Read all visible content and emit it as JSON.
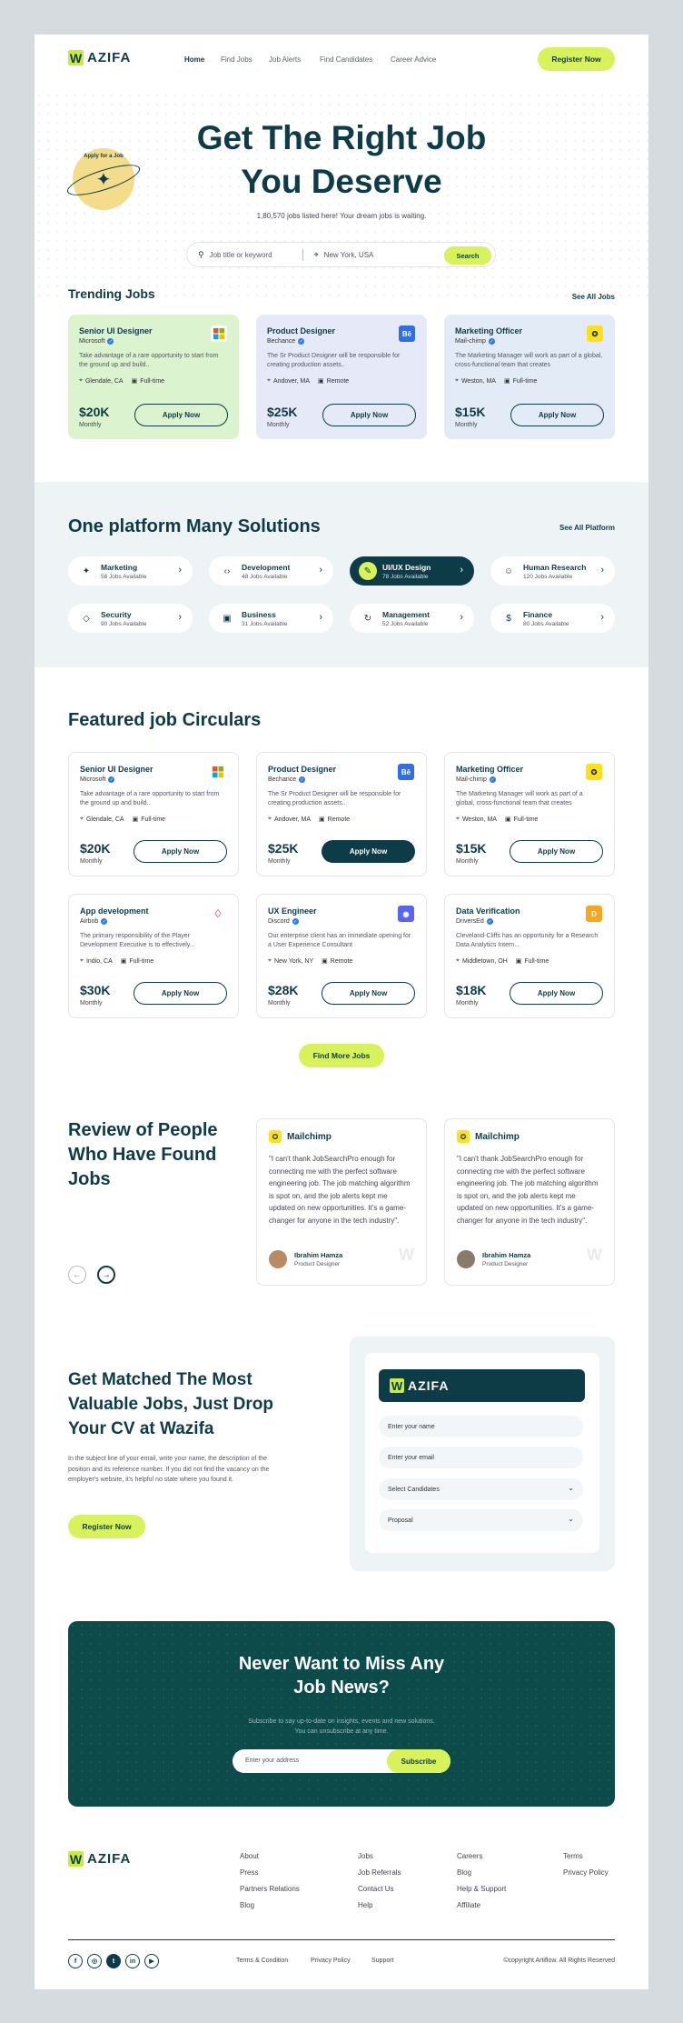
{
  "brand": {
    "logo_mark": "W",
    "logo_text": "AZIFA"
  },
  "nav": {
    "items": [
      "Home",
      "Find Jobs",
      "Job Alerts",
      "Find Candidates",
      "Career Advice"
    ],
    "cta": "Register Now"
  },
  "hero": {
    "title_line1": "Get The Right Job",
    "title_line2": "You Deserve",
    "badge": "Apply for a Job",
    "subtitle": "1,80,570 jobs listed here! Your dream jobs is waiting.",
    "search_placeholder": "Job title or keyword",
    "location_placeholder": "New York, USA",
    "search_button": "Search"
  },
  "trending": {
    "title": "Trending Jobs",
    "see_all": "See All Jobs",
    "jobs": [
      {
        "title": "Senior UI Designer",
        "company": "Microsoft",
        "desc": "Take advantage of a rare opportunity to start from the ground up and build..",
        "location": "Glendale, CA",
        "type": "Full-time",
        "salary": "$20K",
        "period": "Monthly",
        "apply": "Apply Now"
      },
      {
        "title": "Product Designer",
        "company": "Bechance",
        "desc": "The Sr Product Designer will be responsible for creating production assets..",
        "location": "Andover, MA",
        "type": "Remote",
        "salary": "$25K",
        "period": "Monthly",
        "apply": "Apply Now"
      },
      {
        "title": "Marketing Officer",
        "company": "Mail-chimp",
        "desc": "The Marketing Manager will work as part of a global, cross-functional team that creates",
        "location": "Weston, MA",
        "type": "Full-time",
        "salary": "$15K",
        "period": "Monthly",
        "apply": "Apply Now"
      }
    ]
  },
  "platform": {
    "title": "One platform Many Solutions",
    "see_all": "See All Platform",
    "categories": [
      {
        "name": "Marketing",
        "count": "58 Jobs Available",
        "icon": "megaphone-icon",
        "glyph": "✦"
      },
      {
        "name": "Development",
        "count": "48 Jobs Available",
        "icon": "code-icon",
        "glyph": "‹›"
      },
      {
        "name": "UI/UX Design",
        "count": "78 Jobs Available",
        "icon": "pen-icon",
        "glyph": "✎"
      },
      {
        "name": "Human Research",
        "count": "120 Jobs Available",
        "icon": "people-icon",
        "glyph": "☺"
      },
      {
        "name": "Security",
        "count": "90 Jobs Available",
        "icon": "shield-icon",
        "glyph": "◇"
      },
      {
        "name": "Business",
        "count": "31 Jobs Available",
        "icon": "briefcase-icon",
        "glyph": "▣"
      },
      {
        "name": "Management",
        "count": "52 Jobs Available",
        "icon": "refresh-icon",
        "glyph": "↻"
      },
      {
        "name": "Finance",
        "count": "80 Jobs Available",
        "icon": "money-icon",
        "glyph": "$"
      }
    ]
  },
  "featured": {
    "title": "Featured job Circulars",
    "more": "Find More Jobs",
    "jobs": [
      {
        "title": "Senior UI Designer",
        "company": "Microsoft",
        "desc": "Take advantage of a rare opportunity to start from the ground up and build..",
        "location": "Glendale, CA",
        "type": "Full-time",
        "salary": "$20K",
        "period": "Monthly",
        "apply": "Apply Now"
      },
      {
        "title": "Product Designer",
        "company": "Bechance",
        "desc": "The Sr Product Designer will be responsible for creating production assets..",
        "location": "Andover, MA",
        "type": "Remote",
        "salary": "$25K",
        "period": "Monthly",
        "apply": "Apply Now"
      },
      {
        "title": "Marketing Officer",
        "company": "Mail-chimp",
        "desc": "The Marketing Manager will work as part of a global, cross-functional team that creates",
        "location": "Weston, MA",
        "type": "Full-time",
        "salary": "$15K",
        "period": "Monthly",
        "apply": "Apply Now"
      },
      {
        "title": "App development",
        "company": "Airbnb",
        "desc": "The primary responsibility of the Player Development Executive is to effectively...",
        "location": "Indio, CA",
        "type": "Full-time",
        "salary": "$30K",
        "period": "Monthly",
        "apply": "Apply Now"
      },
      {
        "title": "UX Engineer",
        "company": "Discord",
        "desc": "Our enterprise client has an immediate opening for a User Experience Consultant",
        "location": "New York, NY",
        "type": "Remote",
        "salary": "$28K",
        "period": "Monthly",
        "apply": "Apply Now"
      },
      {
        "title": "Data Verification",
        "company": "DriversEd",
        "desc": "Cleveland-Cliffs has an opportunity for a Research Data Analytics Intern...",
        "location": "Middletown, OH",
        "type": "Full-time",
        "salary": "$18K",
        "period": "Monthly",
        "apply": "Apply Now"
      }
    ]
  },
  "reviews": {
    "title_line1": "Review of People",
    "title_line2": "Who Have Found",
    "title_line3": "Jobs",
    "items": [
      {
        "company": "Mailchimp",
        "text": "\"I can't thank JobSearchPro enough for connecting me with the perfect software engineering job. The job matching algorithm is spot on, and the job alerts kept me updated on new opportunities. It's a game-changer for anyone in the tech industry\".",
        "name": "Ibrahim Hamza",
        "role": "Product Designer"
      },
      {
        "company": "Mailchimp",
        "text": "\"I can't thank JobSearchPro enough for connecting me with the perfect software engineering job. The job matching algorithm is spot on, and the job alerts kept me updated on new opportunities. It's a game-changer for anyone in the tech industry\".",
        "name": "Ibrahim Hamza",
        "role": "Product Designer"
      }
    ]
  },
  "cv": {
    "title_line1": "Get Matched The Most",
    "title_line2": "Valuable Jobs, Just Drop",
    "title_line3": "Your CV at Wazifa",
    "desc": "In the subject line of your email, write your name, the description of the position and its reference number. If you did not find the vacancy on the employer's website, it's helpful no state where you found it.",
    "button": "Register Now",
    "form": {
      "name_placeholder": "Enter your name",
      "email_placeholder": "Enter your email",
      "select1": "Select Candidates",
      "select2": "Proposal"
    }
  },
  "newsletter": {
    "title_line1": "Never Want to Miss Any",
    "title_line2": "Job News?",
    "desc_line1": "Subscribe to say up-to-date on insights, events and new solutions.",
    "desc_line2": "You can unsubscribe at any time.",
    "placeholder": "Enter your address",
    "button": "Subscribe"
  },
  "footer": {
    "col1": [
      "About",
      "Press",
      "Partners Relations",
      "Blog"
    ],
    "col2": [
      "Jobs",
      "Job Referrals",
      "Contact Us",
      "Help"
    ],
    "col3": [
      "Careers",
      "Blog",
      "Help & Support",
      "Affiliate"
    ],
    "col4": [
      "Terms",
      "Privacy Policy"
    ],
    "bottom_links": [
      "Terms & Condition",
      "Privacy Policy",
      "Support"
    ],
    "social": [
      "f",
      "◎",
      "t",
      "in",
      "▶"
    ],
    "copyright": "©copyright Artiflow. All Rights Reserved"
  },
  "colors": {
    "dark": "#0d3b47",
    "lime": "#d7f25a",
    "green_card": "#dcf3cf",
    "purple_card": "#e6e9f7",
    "blue_card": "#e3ebf7",
    "section_bg": "#eef3f5"
  }
}
